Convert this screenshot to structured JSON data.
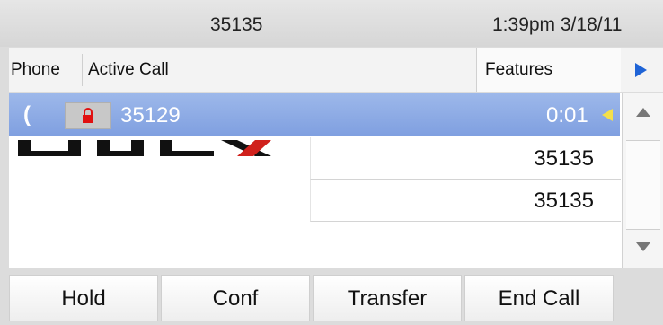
{
  "status_bar": {
    "extension": "35135",
    "time": "1:39pm 3/18/11"
  },
  "tabs": {
    "phone_label": "Phone",
    "active_label": "Active Call",
    "features_label": "Features"
  },
  "active_call": {
    "extension": "35129",
    "duration": "0:01",
    "icons": [
      "handset-icon",
      "lock-icon"
    ]
  },
  "lines": [
    {
      "number": "35135"
    },
    {
      "number": "35135"
    }
  ],
  "softkeys": {
    "hold": "Hold",
    "conf": "Conf",
    "transfer": "Transfer",
    "end_call": "End Call"
  },
  "colors": {
    "active_row": "#8aa8e6",
    "lock": "#e01010",
    "features_arrow": "#1e63d6",
    "call_indicator": "#f4e04a"
  }
}
